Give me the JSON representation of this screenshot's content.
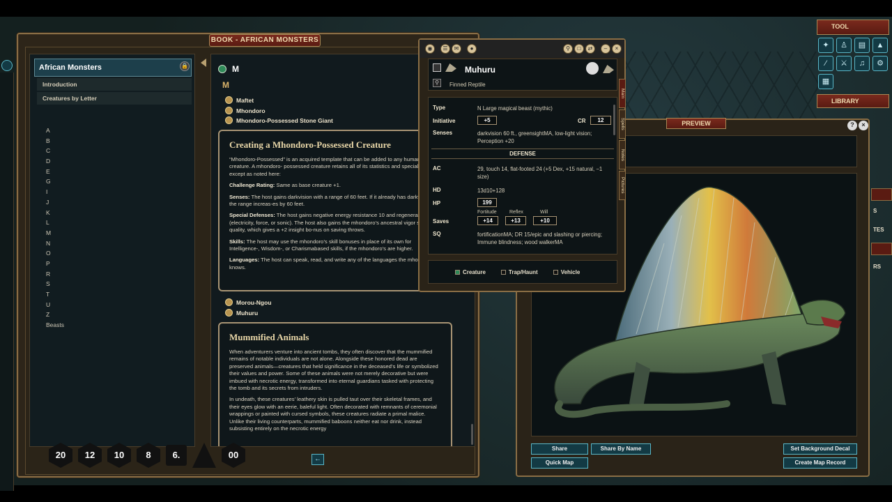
{
  "book": {
    "title": "BOOK - AFRICAN MONSTERS",
    "sidebar": {
      "header": "African Monsters",
      "intro": "Introduction",
      "by_letter": "Creatures by Letter",
      "letters": [
        "A",
        "B",
        "C",
        "D",
        "E",
        "G",
        "I",
        "J",
        "K",
        "L",
        "M",
        "N",
        "O",
        "P",
        "R",
        "S",
        "T",
        "U",
        "Z",
        "Beasts"
      ]
    },
    "content": {
      "heading": "M",
      "letter": "M",
      "links_top": [
        "Maftet",
        "Mhondoro",
        "Mhondoro-Possessed Stone Giant"
      ],
      "card1": {
        "title": "Creating a Mhondoro-Possessed Creature",
        "p1": "“Mhondoro-Possessed” is an acquired template that can be added to any humanoid creature. A mhondoro- possessed creature retains all of its statistics and special abilities except as noted here:",
        "cr_label": "Challenge Rating:",
        "cr_text": " Same as base creature +1.",
        "senses_label": "Senses:",
        "senses_text": " The host gains darkvision with a range of 60 feet. If it already has darkvision, the range increas-es by 60 feet.",
        "sd_label": "Special Defenses:",
        "sd_text": " The host gains negative energy resistance 10 and regeneration 5 (electricity, force, or sonic). The host also gains the mhondoro’s ancestral vigor special quality, which gives a +2 insight bo-nus on saving throws.",
        "skills_label": "Skills:",
        "skills_text": " The host may use the mhondoro’s skill bonuses in place of its own for Intelligence-, Wisdom-, or Charismabased skills, if the mhondoro’s are higher.",
        "lang_label": "Languages:",
        "lang_text": " The host can speak, read, and write any of the languages the mhondoro knows."
      },
      "links_mid": [
        "Morou-Ngou",
        "Muhuru"
      ],
      "card2": {
        "title": "Mummified Animals",
        "p1": "When adventurers venture into ancient tombs, they often discover that the mummified remains of notable individuals are not alone. Alongside these honored dead are preserved animals—creatures that held significance in the deceased’s life or symbolized their values and power. Some of these animals were not merely decorative but were imbued with necrotic energy, transformed into eternal guardians tasked with protecting the tomb and its secrets from intruders.",
        "p2": "In undeath, these creatures’ leathery skin is pulled taut over their skeletal frames, and their eyes glow with an eerie, baleful light. Often decorated with remnants of ceremonial wrappings or painted with cursed symbols, these creatures radiate a primal malice. Unlike their living counterparts, mummified baboons neither eat nor drink, instead subsisting entirely on the necrotic energy"
      }
    },
    "dice": [
      "20",
      "12",
      "10",
      "8",
      "6.",
      "",
      "00"
    ]
  },
  "record": {
    "name": "Muhuru",
    "type": "Finned Reptile",
    "stats": {
      "type_label": "Type",
      "type_value": "N Large magical beast (mythic)",
      "init_label": "Initiative",
      "init_value": "+5",
      "cr_label": "CR",
      "cr_value": "12",
      "senses_label": "Senses",
      "senses_value": "darkvision 60 ft., greensightMA, low-light vision; Perception +20",
      "defense": "DEFENSE",
      "ac_label": "AC",
      "ac_value": "29, touch 14, flat-footed 24 (+5 Dex, +15 natural, −1 size)",
      "hd_label": "HD",
      "hd_value": "13d10+128",
      "hp_label": "HP",
      "hp_value": "199",
      "saves_label": "Saves",
      "fort_label": "Fortitude",
      "fort_value": "+14",
      "ref_label": "Reflex",
      "ref_value": "+13",
      "will_label": "Will",
      "will_value": "+10",
      "sq_label": "SQ",
      "sq_value": "fortificationMA; DR 15/epic and slashing or piercing; Immune blindness; wood walkerMA"
    },
    "tabs": [
      "Main",
      "Spells",
      "Notes",
      "Pictures"
    ],
    "footer": {
      "creature": "Creature",
      "trap": "Trap/Haunt",
      "vehicle": "Vehicle"
    }
  },
  "preview": {
    "title": "PREVIEW",
    "share": "Share",
    "share_by_name": "Share By Name",
    "quick_map": "Quick Map",
    "set_bg": "Set Background Decal",
    "create_map": "Create Map Record"
  },
  "tool": {
    "title": "TOOL",
    "library": "LIBRARY",
    "side_texts": [
      "S",
      "TES",
      "RS"
    ]
  }
}
